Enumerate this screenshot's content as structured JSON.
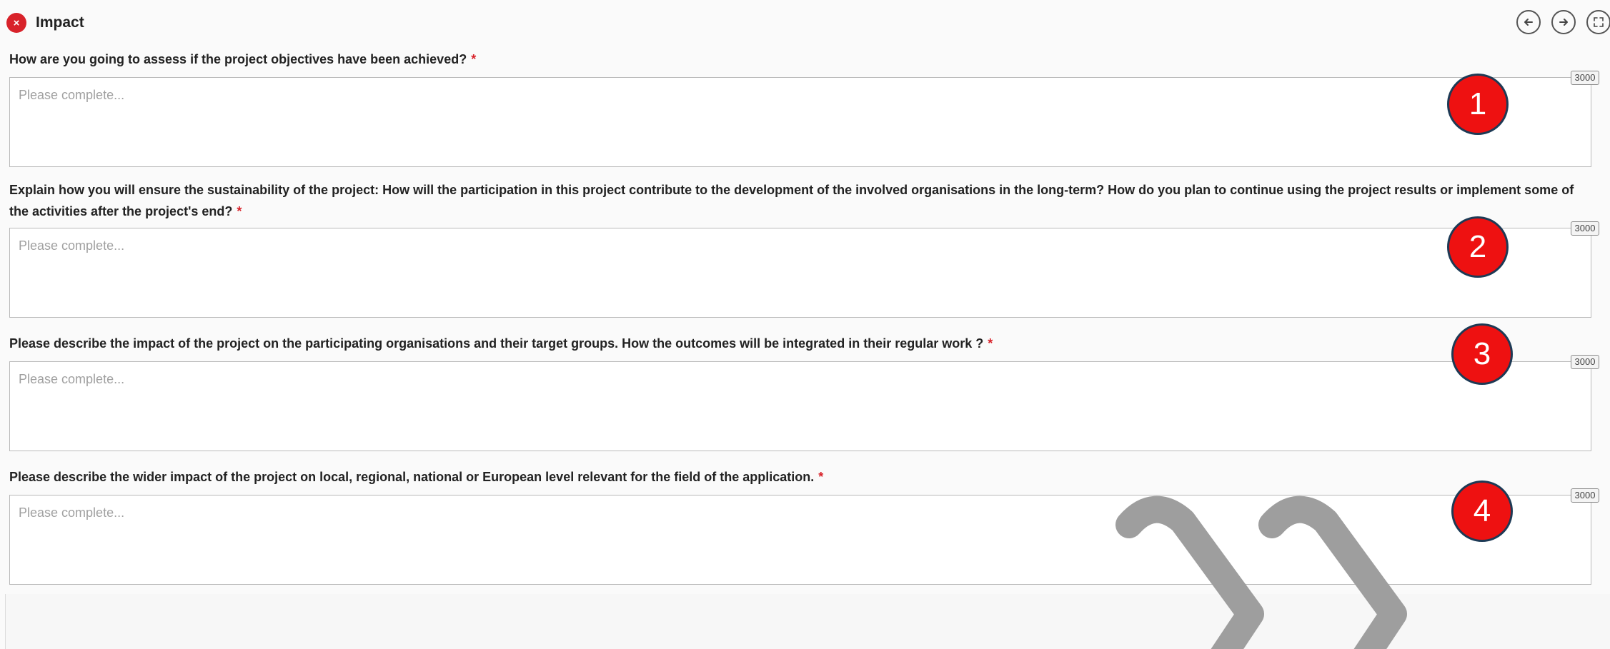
{
  "section": {
    "title": "Impact",
    "status_glyph": "×"
  },
  "nav": {
    "prev_icon": "arrow-left-icon",
    "next_icon": "arrow-right-icon",
    "fullscreen_icon": "fullscreen-icon"
  },
  "questions": [
    {
      "label": "How are you going to assess if the project objectives have been achieved?",
      "required_mark": "*",
      "placeholder": "Please complete...",
      "value": "",
      "max_chars": "3000",
      "callout": "1"
    },
    {
      "label": "Explain how you will ensure the sustainability of the project: How will the participation in this project contribute to the development of the involved organisations in the long-term? How do you plan to continue using the project results or implement some of the activities after the project's end?",
      "required_mark": "*",
      "placeholder": "Please complete...",
      "value": "",
      "max_chars": "3000",
      "callout": "2"
    },
    {
      "label": "Please describe the impact of the project on the participating organisations and their target groups. How the outcomes will be integrated in their regular work ?",
      "required_mark": "*",
      "placeholder": "Please complete...",
      "value": "",
      "max_chars": "3000",
      "callout": "3"
    },
    {
      "label": "Please describe the wider impact of the project on local, regional, national or European level relevant for the field of the application.",
      "required_mark": "*",
      "placeholder": "Please complete...",
      "value": "",
      "max_chars": "3000",
      "callout": "4"
    }
  ],
  "colors": {
    "required": "#d8222a",
    "callout_fill": "#ee1111",
    "callout_border": "#1d3a55",
    "watermark": "#9e9e9e"
  }
}
